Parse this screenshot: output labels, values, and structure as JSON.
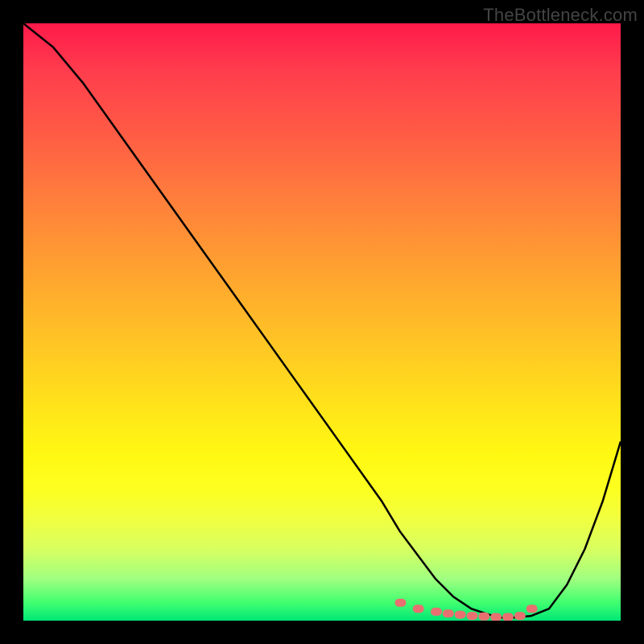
{
  "watermark": "TheBottleneck.com",
  "chart_data": {
    "type": "line",
    "title": "",
    "xlabel": "",
    "ylabel": "",
    "xlim": [
      0,
      100
    ],
    "ylim": [
      0,
      100
    ],
    "background_gradient": {
      "top_color": "#ff1a4a",
      "mid_color": "#ffe818",
      "bottom_color": "#00e676",
      "note": "vertical gradient red→orange→yellow→green representing heat/bottleneck severity"
    },
    "series": [
      {
        "name": "bottleneck-curve",
        "color": "#000000",
        "x": [
          0,
          5,
          10,
          15,
          20,
          25,
          30,
          35,
          40,
          45,
          50,
          55,
          60,
          63,
          66,
          69,
          72,
          75,
          78,
          80,
          82,
          85,
          88,
          91,
          94,
          97,
          100
        ],
        "y": [
          100,
          96,
          90,
          83,
          76,
          69,
          62,
          55,
          48,
          41,
          34,
          27,
          20,
          15,
          11,
          7,
          4,
          2,
          1,
          0.5,
          0.5,
          0.8,
          2,
          6,
          12,
          20,
          30
        ]
      },
      {
        "name": "highlight-dots",
        "color": "#e87070",
        "type": "scatter",
        "x": [
          63,
          66,
          69,
          71,
          73,
          75,
          77,
          79,
          81,
          83,
          85
        ],
        "y": [
          3,
          2,
          1.5,
          1.2,
          1,
          0.8,
          0.7,
          0.6,
          0.6,
          0.8,
          2
        ]
      }
    ]
  }
}
